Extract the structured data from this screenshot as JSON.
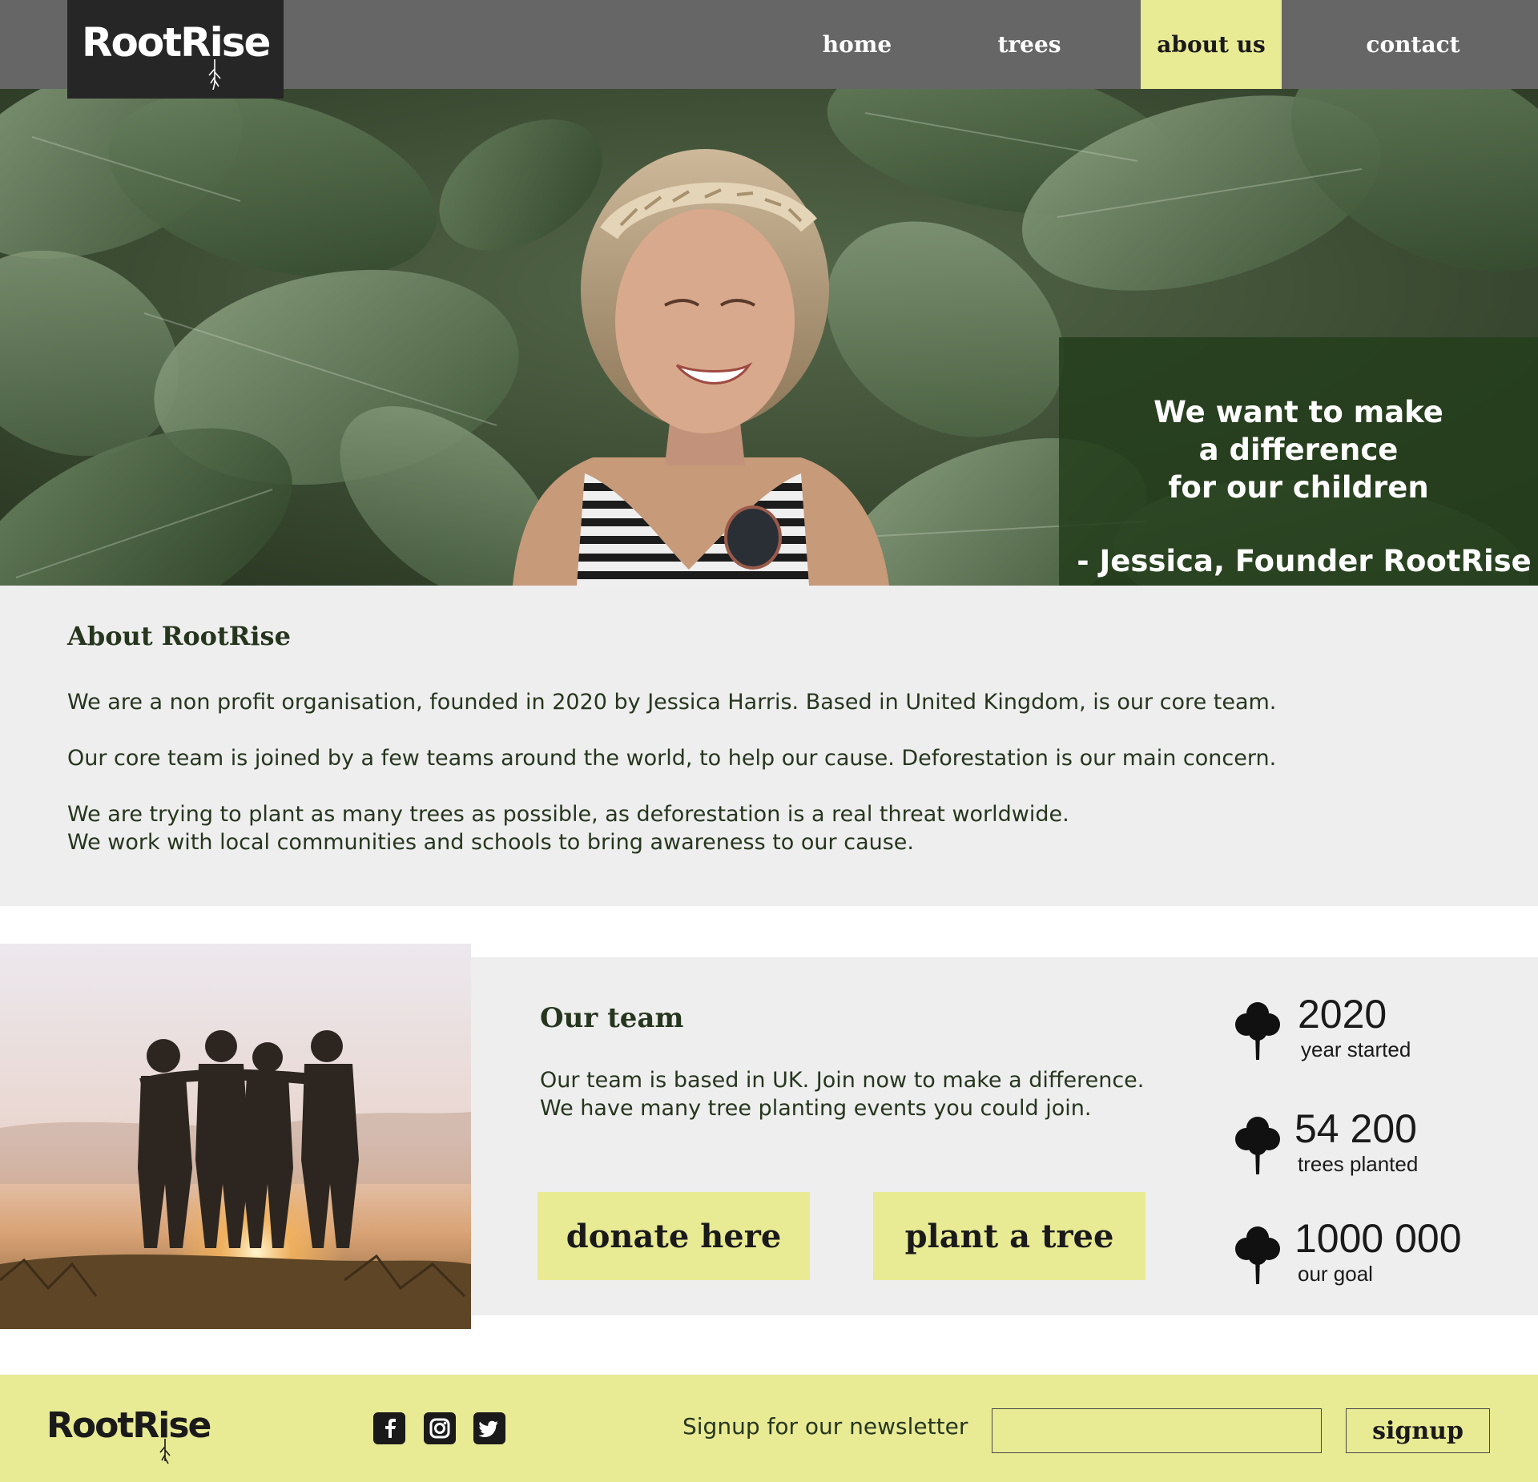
{
  "brand": {
    "name": "RootRise"
  },
  "nav": {
    "items": [
      {
        "label": "home"
      },
      {
        "label": "trees"
      },
      {
        "label": "about us"
      },
      {
        "label": "contact"
      }
    ],
    "active": "about us"
  },
  "hero": {
    "quote": "We want to make\na difference\nfor our children",
    "author": "- Jessica, Founder RootRise"
  },
  "about": {
    "title": "About RootRise",
    "paragraphs": [
      "We are a non profit organisation, founded in 2020 by Jessica Harris. Based in United Kingdom, is our core team.",
      "Our core team is joined by a few teams around the world, to help our cause. Deforestation is our main concern.",
      "We are trying to plant as many trees as possible, as deforestation is a real threat worldwide.",
      "We work with local communities and schools to bring awareness to our cause."
    ]
  },
  "team": {
    "title": "Our team",
    "lines": [
      "Our team is based in UK. Join now to make a difference.",
      "We have many tree planting events you could join."
    ],
    "donate_label": "donate here",
    "plant_label": "plant a tree",
    "stats": [
      {
        "value": "2020",
        "label": "year started",
        "icon": "tree-icon"
      },
      {
        "value": "54 200",
        "label": "trees planted",
        "icon": "tree-icon"
      },
      {
        "value": "1000 000",
        "label": "our goal",
        "icon": "tree-icon"
      }
    ]
  },
  "footer": {
    "social": [
      {
        "icon": "facebook-icon"
      },
      {
        "icon": "instagram-icon"
      },
      {
        "icon": "twitter-icon"
      }
    ],
    "newsletter_label": "Signup for our newsletter",
    "newsletter_placeholder": "",
    "signup_label": "signup"
  },
  "colors": {
    "header_bg": "#666666",
    "logo_bg": "#262626",
    "accent": "#e8ea94",
    "quote_bg": "#243e1c",
    "section_bg": "#eeeeee",
    "text_dark": "#26361e"
  }
}
